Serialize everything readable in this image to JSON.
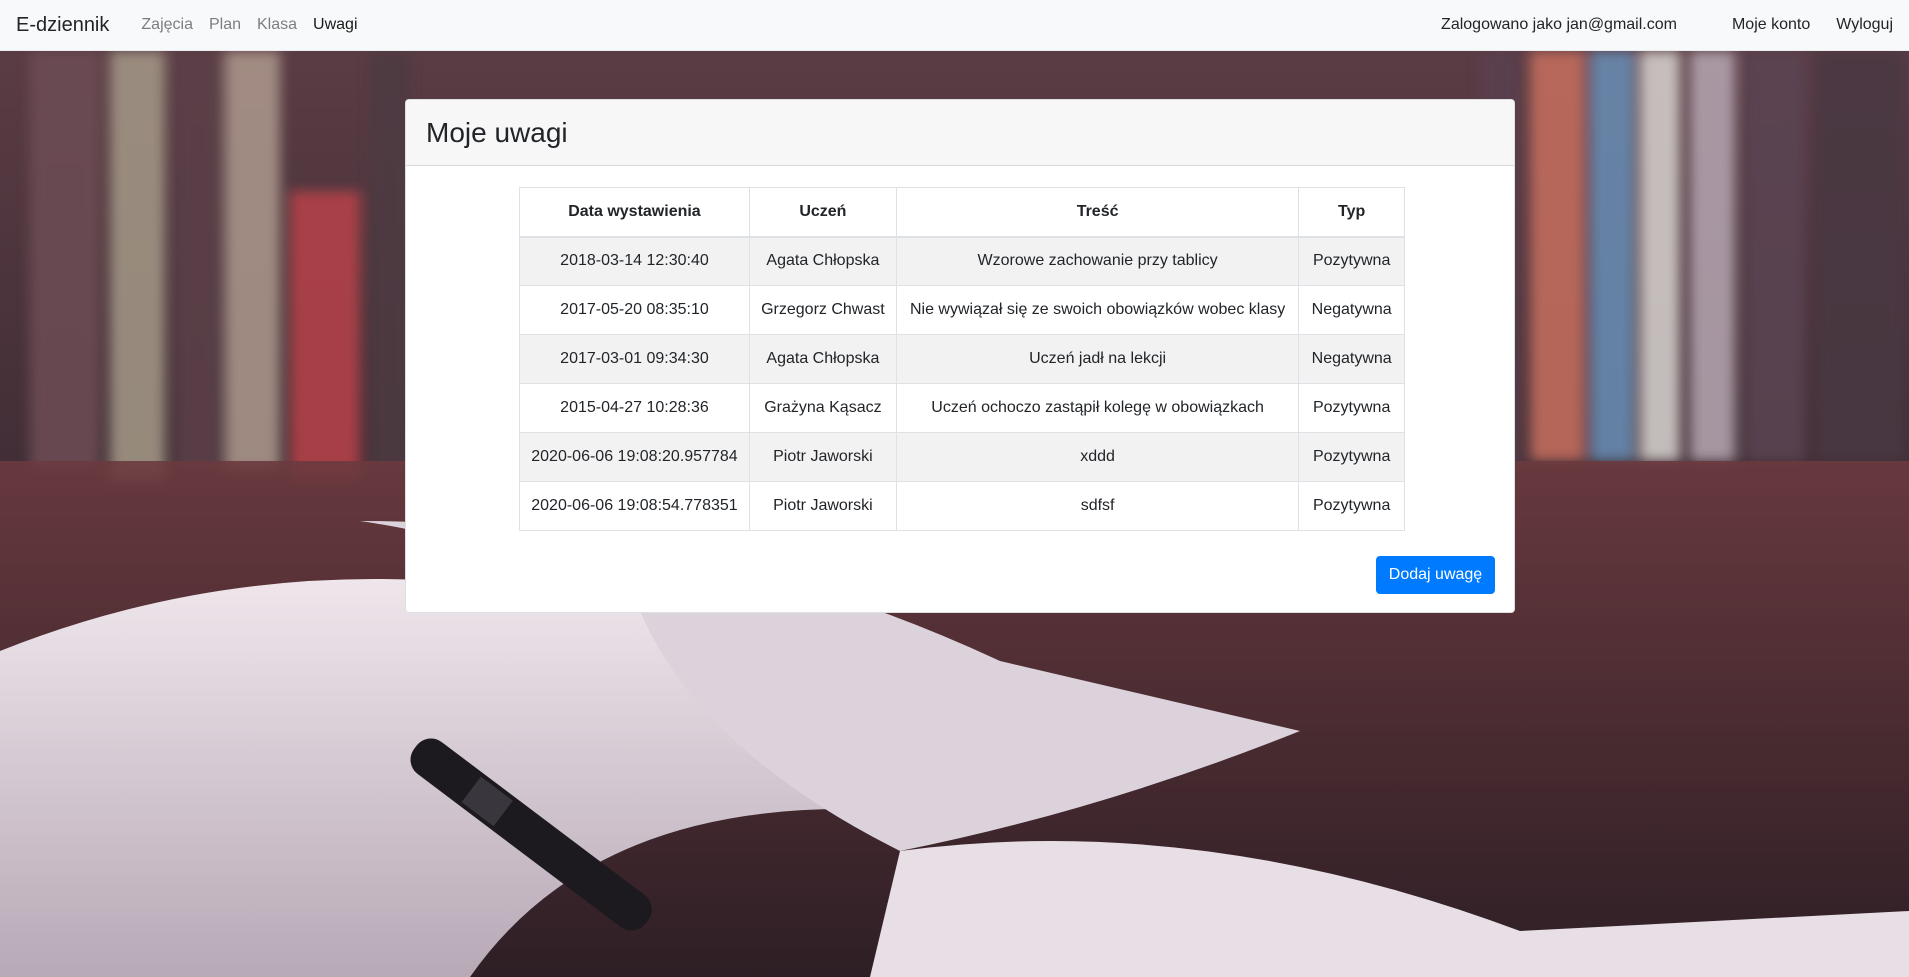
{
  "navbar": {
    "brand": "E-dziennik",
    "links": [
      "Zajęcia",
      "Plan",
      "Klasa",
      "Uwagi"
    ],
    "active": "Uwagi",
    "logged_in_text": "Zalogowano jako jan@gmail.com",
    "account_label": "Moje konto",
    "logout_label": "Wyloguj"
  },
  "card": {
    "title": "Moje uwagi",
    "table": {
      "headers": [
        "Data wystawienia",
        "Uczeń",
        "Treść",
        "Typ"
      ],
      "rows": [
        [
          "2018-03-14 12:30:40",
          "Agata Chłopska",
          "Wzorowe zachowanie przy tablicy",
          "Pozytywna"
        ],
        [
          "2017-05-20 08:35:10",
          "Grzegorz Chwast",
          "Nie wywiązał się ze swoich obowiązków wobec klasy",
          "Negatywna"
        ],
        [
          "2017-03-01 09:34:30",
          "Agata Chłopska",
          "Uczeń jadł na lekcji",
          "Negatywna"
        ],
        [
          "2015-04-27 10:28:36",
          "Grażyna Kąsacz",
          "Uczeń ochoczo zastąpił kolegę w obowiązkach",
          "Pozytywna"
        ],
        [
          "2020-06-06 19:08:20.957784",
          "Piotr Jaworski",
          "xddd",
          "Pozytywna"
        ],
        [
          "2020-06-06 19:08:54.778351",
          "Piotr Jaworski",
          "sdfsf",
          "Pozytywna"
        ]
      ]
    },
    "add_button": "Dodaj uwagę"
  },
  "colors": {
    "primary": "#007bff",
    "navbar_bg": "#f8f9fa",
    "card_header_bg": "#f7f7f7",
    "stripe": "#f2f2f2"
  }
}
